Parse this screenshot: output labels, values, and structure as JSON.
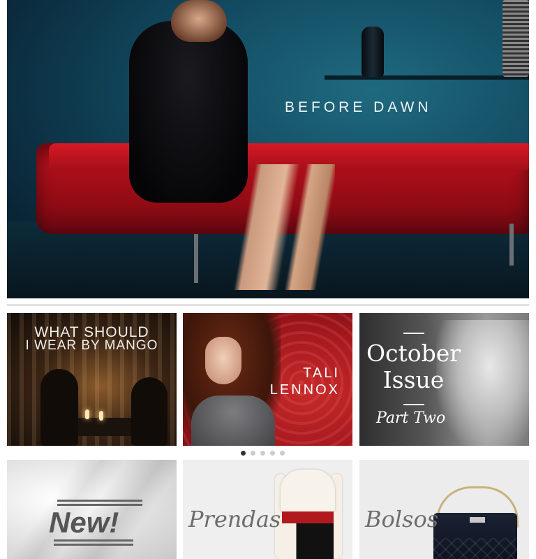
{
  "hero": {
    "title": "BEFORE DAWN"
  },
  "promos": [
    {
      "line1": "WHAT SHOULD",
      "line2": "I WEAR BY MANGO"
    },
    {
      "line1": "TALI",
      "line2": "LENNOX"
    },
    {
      "line1": "October",
      "line2": "Issue",
      "line3": "Part Two"
    }
  ],
  "carousel": {
    "dots": 5,
    "active": 0
  },
  "categories": [
    {
      "label": "New!"
    },
    {
      "label": "Prendas"
    },
    {
      "label": "Bolsos"
    }
  ]
}
